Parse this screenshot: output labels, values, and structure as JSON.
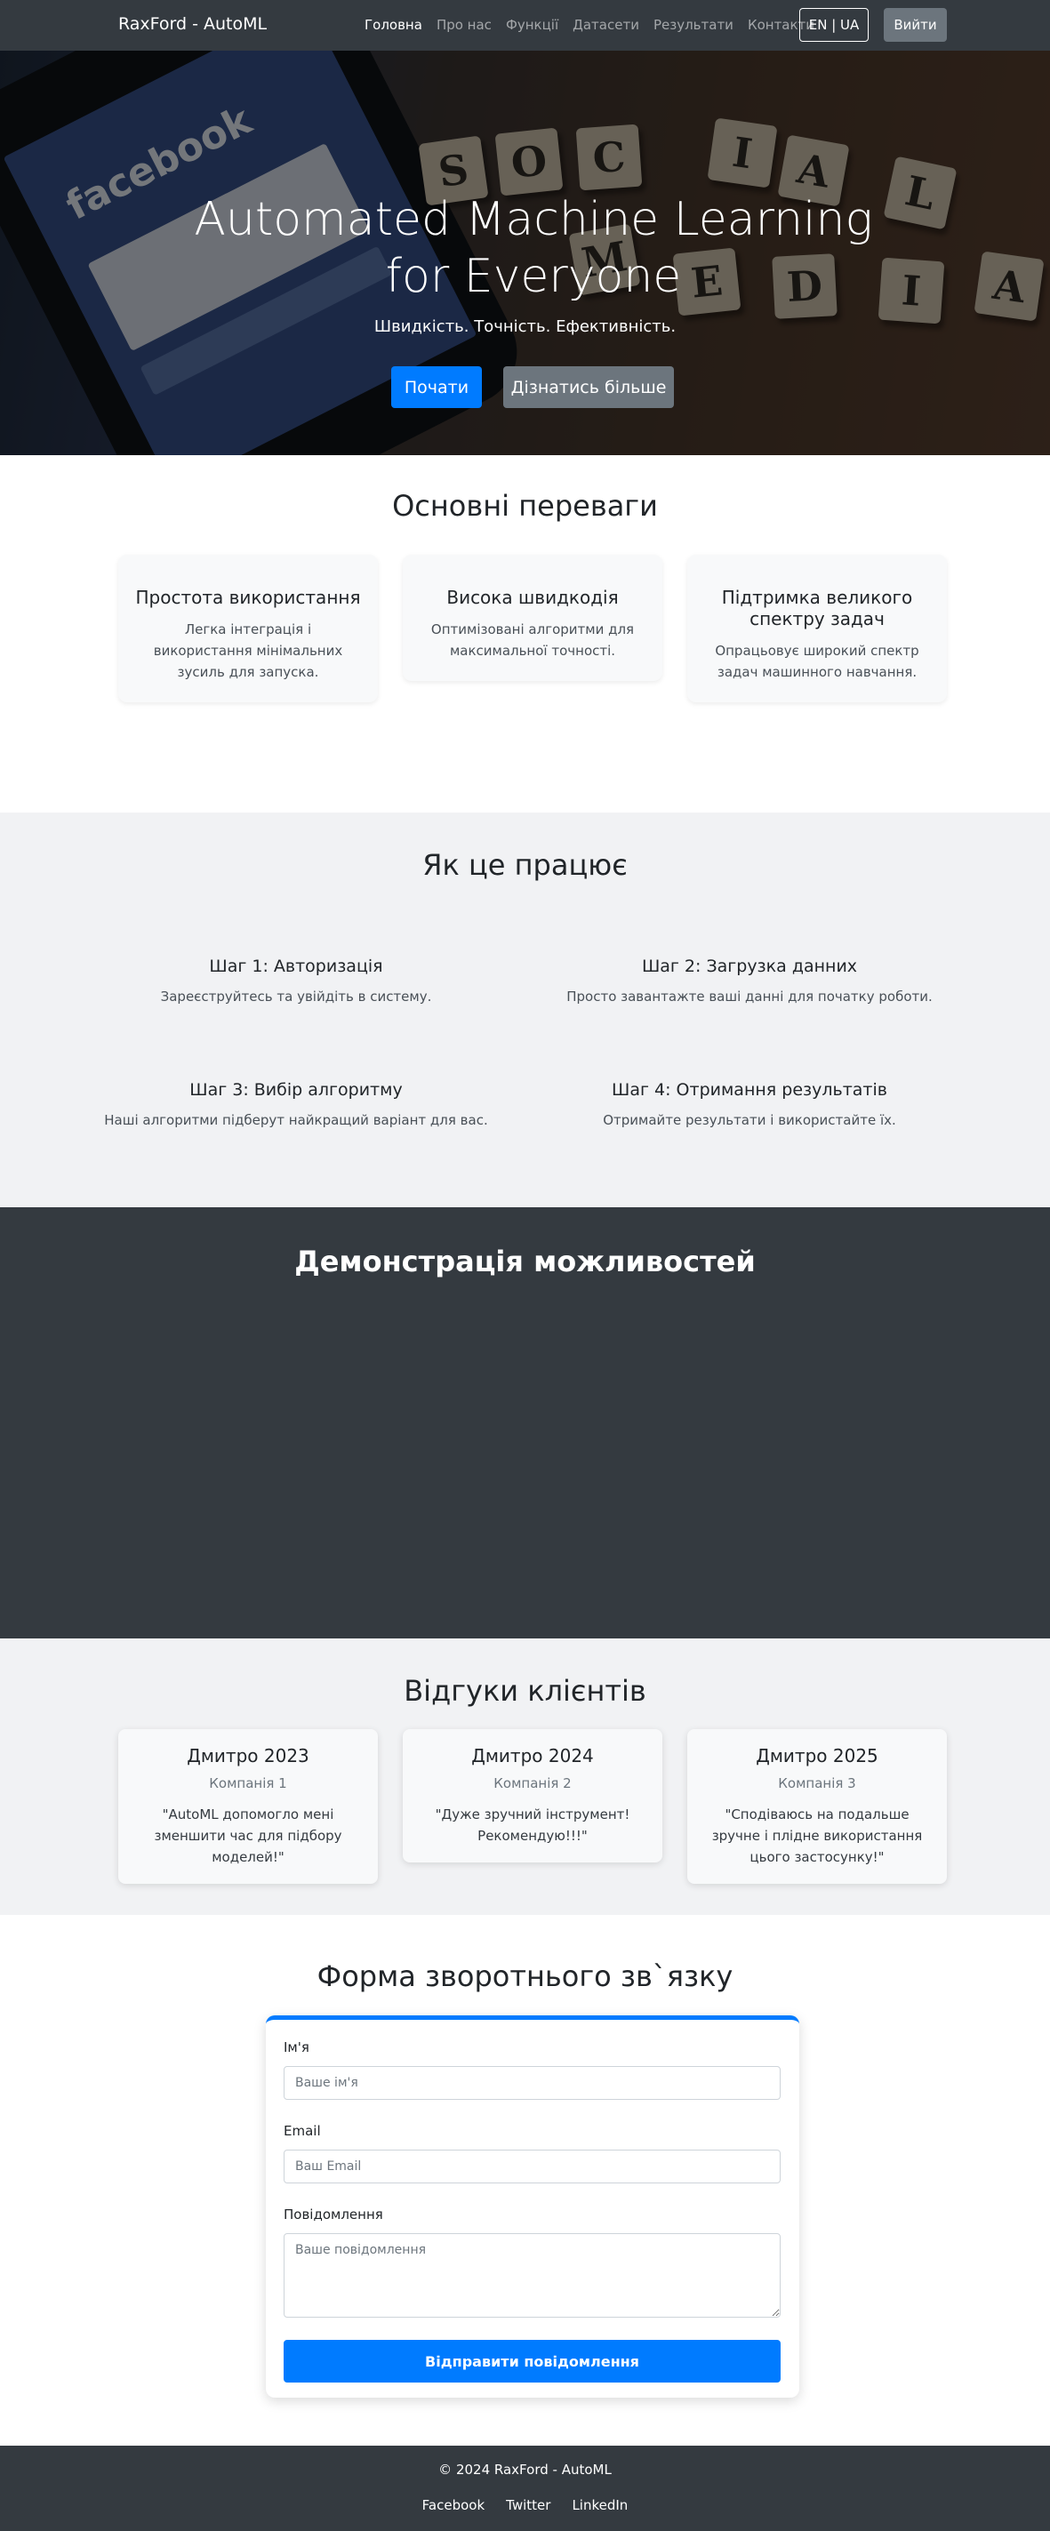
{
  "navbar": {
    "brand": "RaxFord - AutoML",
    "links": [
      "Головна",
      "Про нас",
      "Функції",
      "Датасети",
      "Результати",
      "Контакти"
    ],
    "lang": "EN | UA",
    "logout": "Вийти"
  },
  "hero": {
    "title": "Automated Machine Learning for Everyone",
    "subtitle": "Швидкість. Точність. Ефективність.",
    "primary_button": "Почати",
    "secondary_button": "Дізнатись більше",
    "image_texts": {
      "phone_logo": "facebook",
      "tiles_top": [
        "S",
        "O",
        "C",
        "I",
        "A",
        "L"
      ],
      "tiles_bottom": [
        "M",
        "E",
        "D",
        "I",
        "A"
      ]
    }
  },
  "features": {
    "title": "Основні переваги",
    "cards": [
      {
        "title": "Простота використання",
        "text": "Легка інтеграція і використання мінімальних зусиль для запуска."
      },
      {
        "title": "Висока швидкодія",
        "text": "Оптимізовані алгоритми для максимальної точності."
      },
      {
        "title": "Підтримка великого спектру задач",
        "text": "Опрацьовує широкий спектр задач машинного навчання."
      }
    ]
  },
  "how_it_works": {
    "title": "Як це працює",
    "steps": [
      {
        "title": "Шаг 1: Авторизація",
        "text": "Зареєструйтесь та увійдіть в систему."
      },
      {
        "title": "Шаг 2: Загрузка данних",
        "text": "Просто завантажте ваші данні для початку роботи."
      },
      {
        "title": "Шаг 3: Вибір алгоритму",
        "text": "Наші алгоритми підберут найкращий варіант для вас."
      },
      {
        "title": "Шаг 4: Отримання результатів",
        "text": "Отримайте результати і використайте їх."
      }
    ]
  },
  "demo": {
    "title": "Демонстрація можливостей"
  },
  "testimonials": {
    "title": "Відгуки клієнтів",
    "items": [
      {
        "name": "Дмитро 2023",
        "company": "Компанія 1",
        "quote": "\"AutoML допомогло мені зменшити час для підбору моделей!\""
      },
      {
        "name": "Дмитро 2024",
        "company": "Компанія 2",
        "quote": "\"Дуже зручний інструмент! Рекомендую!!!\""
      },
      {
        "name": "Дмитро 2025",
        "company": "Компанія 3",
        "quote": "\"Сподіваюсь на подальше зручне і плідне використання цього застосунку!\""
      }
    ]
  },
  "contact": {
    "title": "Форма зворотнього зв`язку",
    "name_label": "Ім'я",
    "name_placeholder": "Ваше ім'я",
    "email_label": "Email",
    "email_placeholder": "Ваш Email",
    "message_label": "Повідомлення",
    "message_placeholder": "Ваше повідомлення",
    "submit": "Відправити повідомлення"
  },
  "footer": {
    "copyright": "© 2024 RaxFord - AutoML",
    "links": [
      "Facebook",
      "Twitter",
      "LinkedIn"
    ]
  },
  "colors": {
    "primary": "#007bff",
    "secondary": "#6c757d",
    "dark": "#343a40",
    "light_section": "#f1f2f4"
  }
}
